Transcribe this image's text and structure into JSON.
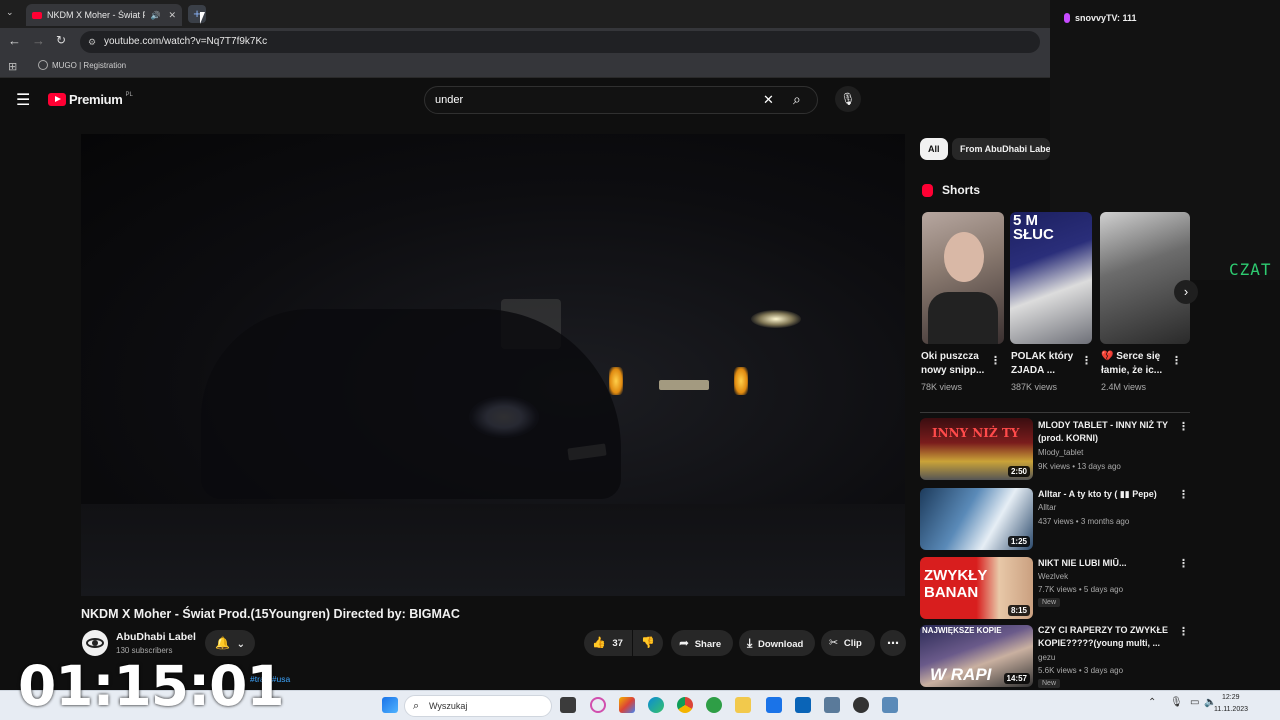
{
  "browser": {
    "tab_title": "NKDM X Moher - Świat Pro",
    "url": "youtube.com/watch?v=Nq7T7f9k7Kc",
    "bookmark_label": "MUGO | Registration"
  },
  "stream_overlay": {
    "chat_line": "snovvyTV: 111",
    "side_text": "CZAT"
  },
  "header": {
    "logo_text": "Premium",
    "logo_region": "PL",
    "search_value": "under"
  },
  "video": {
    "title": "NKDM X Moher - Świat Prod.(15Youngren) Directed by: BIGMAC",
    "channel_name": "AbuDhabi Label",
    "subscribers": "130 subscribers",
    "like_count": "37",
    "share_label": "Share",
    "download_label": "Download",
    "clip_label": "Clip",
    "description_hashtags": "#trap #usa"
  },
  "filters": {
    "chips": [
      "All",
      "From AbuDhabi Label"
    ]
  },
  "shorts": {
    "heading": "Shorts",
    "items": [
      {
        "title": "Oki puszcza nowy snipp...",
        "views": "78K views"
      },
      {
        "title": "POLAK który ZJADA ...",
        "views": "387K views"
      },
      {
        "title": "💔 Serce się łamie, że ic...",
        "views": "2.4M views"
      }
    ],
    "thumb2_text": "5 M SŁUC"
  },
  "recommendations": [
    {
      "title": "MLODY TABLET - INNY NIŻ TY (prod. KORNI)",
      "channel": "Mlody_tablet",
      "meta": "9K views • 13 days ago",
      "duration": "2:50",
      "thumb_text": "INNY NIŻ TY",
      "badge": ""
    },
    {
      "title": "Alltar - A ty kto ty ( ▮▮ Pepe)",
      "channel": "Alltar",
      "meta": "437 views • 3 months ago",
      "duration": "1:25",
      "thumb_text": "",
      "badge": ""
    },
    {
      "title": "NIKT NIE LUBI MIŪ...",
      "channel": "Wezlvek",
      "meta": "7.7K views • 5 days ago",
      "duration": "8:15",
      "thumb_text": "ZWYKŁY BANAN",
      "badge": "New"
    },
    {
      "title": "CZY CI RAPERZY TO ZWYKŁE KOPIE?????(young multi, ...",
      "channel": "gezu",
      "meta": "5.6K views • 3 days ago",
      "duration": "14:57",
      "thumb_text": "W RAPI",
      "thumb_text_top": "NAJWIĘKSZE KOPIE",
      "badge": "New"
    }
  ],
  "timer": "01:15:01",
  "taskbar": {
    "search_placeholder": "Wyszukaj",
    "clock_time": "12:29",
    "clock_date": "11.11.2023"
  },
  "colors": {
    "youtube_red": "#ff0033",
    "background": "#0f0f0f",
    "chip_active": "#f1f1f1"
  }
}
